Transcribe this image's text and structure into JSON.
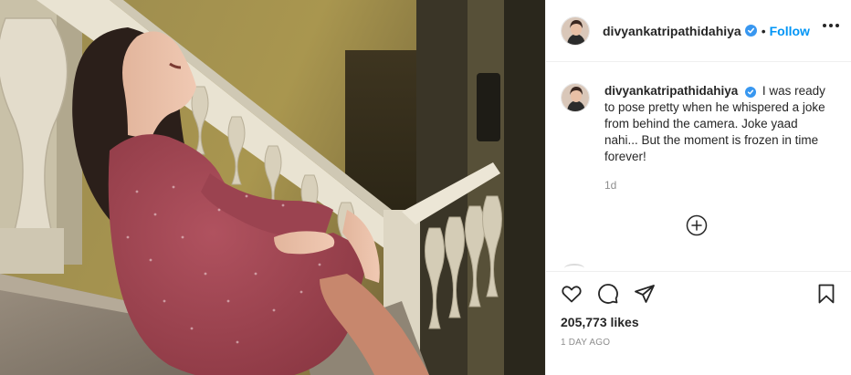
{
  "post": {
    "username": "divyankatripathidahiya",
    "follow_label": "Follow",
    "separator": "•",
    "caption_author": "divyankatripathidahiya",
    "caption_text": "I was ready to pose pretty when he whispered a joke from behind the camera. Joke yaad nahi... But the moment is frozen in time forever!",
    "caption_age": "1d",
    "likes": "205,773 likes",
    "posted": "1 DAY AGO"
  },
  "icons": {
    "verified": "verified-badge-icon",
    "more": "more-options-icon",
    "load_more": "plus-circle-icon",
    "like": "heart-icon",
    "comment": "comment-bubble-icon",
    "share": "paper-plane-icon",
    "save": "bookmark-icon"
  },
  "colors": {
    "follow": "#0095f6",
    "verified": "#3897f0",
    "text": "#262626",
    "muted": "#8e8e8e",
    "dress": "#a64b58"
  }
}
